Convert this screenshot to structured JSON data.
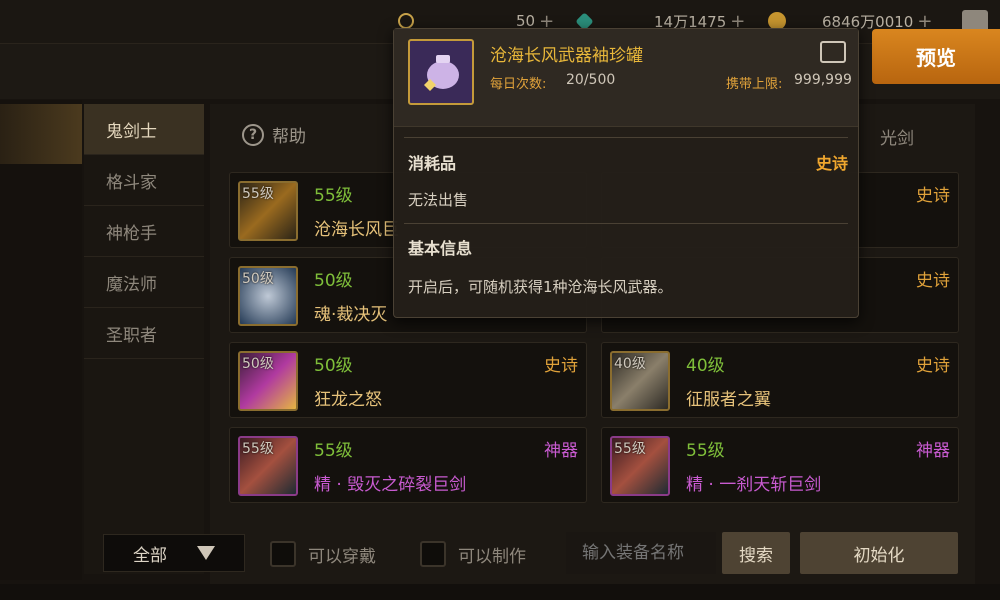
{
  "resources": [
    {
      "icon": "moon-icon",
      "value": "50"
    },
    {
      "icon": "gem-icon",
      "value": "14万1475"
    },
    {
      "icon": "coin-icon",
      "value": "6846万0010"
    }
  ],
  "preview_label": "预览",
  "classes": [
    "鬼剑士",
    "格斗家",
    "神枪手",
    "魔法师",
    "圣职者"
  ],
  "help_label": "帮助",
  "tab_lightsword": "光剑",
  "items": [
    {
      "level_tag": "55级",
      "level": "55级",
      "name": "沧海长风巨",
      "rarity": "",
      "tier": "epic"
    },
    {
      "level_tag": "",
      "level": "",
      "name": "",
      "rarity": "史诗",
      "tier": "epic"
    },
    {
      "level_tag": "50级",
      "level": "50级",
      "name": "魂·裁决灭",
      "rarity": "",
      "tier": "epic"
    },
    {
      "level_tag": "",
      "level": "",
      "name": "",
      "rarity": "史诗",
      "tier": "epic"
    },
    {
      "level_tag": "50级",
      "level": "50级",
      "name": "狂龙之怒",
      "rarity": "史诗",
      "tier": "epic"
    },
    {
      "level_tag": "40级",
      "level": "40级",
      "name": "征服者之翼",
      "rarity": "史诗",
      "tier": "epic"
    },
    {
      "level_tag": "55级",
      "level": "55级",
      "name": "精 · 毁灭之碎裂巨剑",
      "rarity": "神器",
      "tier": "divine"
    },
    {
      "level_tag": "55级",
      "level": "55级",
      "name": "精 · 一刹天斩巨剑",
      "rarity": "神器",
      "tier": "divine"
    }
  ],
  "filter": {
    "selected": "全部"
  },
  "checks": {
    "wearable": "可以穿戴",
    "craftable": "可以制作"
  },
  "search": {
    "placeholder": "输入装备名称",
    "button": "搜索"
  },
  "reset_label": "初始化",
  "tooltip": {
    "title": "沧海长风武器袖珍罐",
    "daily_label": "每日次数:",
    "daily_value": "20/500",
    "cap_label": "携带上限:",
    "cap_value": "999,999",
    "type": "消耗品",
    "rarity": "史诗",
    "sell_status": "无法出售",
    "info_header": "基本信息",
    "description": "开启后，可随机获得1种沧海长风武器。"
  }
}
